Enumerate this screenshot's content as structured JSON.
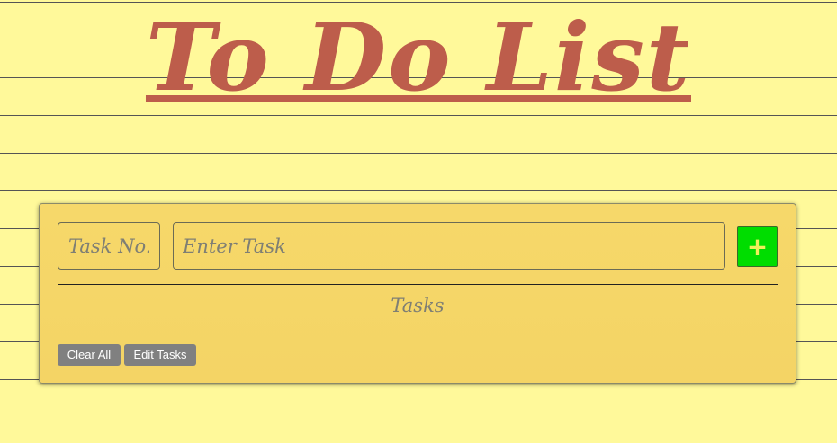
{
  "header": {
    "title": "To Do List"
  },
  "form": {
    "task_no_placeholder": "Task No.",
    "task_placeholder": "Enter Task",
    "add_label": "+"
  },
  "list": {
    "heading": "Tasks"
  },
  "actions": {
    "clear_all_label": "Clear All",
    "edit_tasks_label": "Edit Tasks"
  },
  "colors": {
    "page_background": "#fff99a",
    "title": "#bd5d4b",
    "card": "#f6d86a",
    "add_button": "#00dd00",
    "action_button": "#808080"
  }
}
